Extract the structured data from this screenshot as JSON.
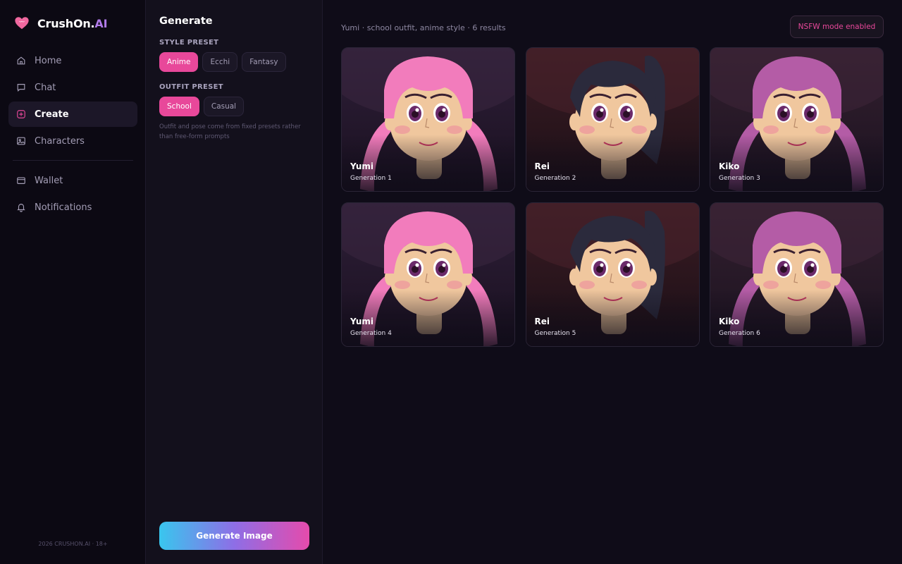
{
  "brand": {
    "name_main": "CrushOn.",
    "name_accent": "AI",
    "icon": "heart-logo-icon",
    "accent_color": "#b07ae8"
  },
  "sidebar": {
    "items": [
      {
        "label": "Home",
        "icon": "home-icon",
        "active": false
      },
      {
        "label": "Chat",
        "icon": "chat-icon",
        "active": false
      },
      {
        "label": "Create",
        "icon": "plus-square-icon",
        "active": true
      },
      {
        "label": "Characters",
        "icon": "image-icon",
        "active": false
      },
      {
        "label": "Wallet",
        "icon": "wallet-icon",
        "active": false
      },
      {
        "label": "Notifications",
        "icon": "bell-icon",
        "active": false
      }
    ],
    "footer": "2026 CRUSHON.AI · 18+"
  },
  "panel": {
    "title": "Generate",
    "style_label": "STYLE PRESET",
    "style_options": [
      "Anime",
      "Ecchi",
      "Fantasy"
    ],
    "style_selected": "Anime",
    "outfit_label": "OUTFIT PRESET",
    "outfit_options": [
      "School",
      "Casual"
    ],
    "outfit_selected": "School",
    "hint": "Outfit and pose come from fixed presets rather than free-form prompts",
    "generate_label": "Generate Image"
  },
  "main": {
    "meta": "Yumi · school outfit, anime style · 6 results",
    "nsfw_label": "NSFW mode enabled",
    "results": [
      {
        "name": "Yumi",
        "caption": "Generation 1"
      },
      {
        "name": "Rei",
        "caption": "Generation 2"
      },
      {
        "name": "Kiko",
        "caption": "Generation 3"
      },
      {
        "name": "Yumi",
        "caption": "Generation 4"
      },
      {
        "name": "Rei",
        "caption": "Generation 5"
      },
      {
        "name": "Kiko",
        "caption": "Generation 6"
      }
    ]
  },
  "colors": {
    "accent_pink": "#e8489a",
    "background": "#0f0c18",
    "yumi_hair": "#f27cbc",
    "rei_hair": "#2b2a3c",
    "kiko_hair": "#b45ca6"
  }
}
